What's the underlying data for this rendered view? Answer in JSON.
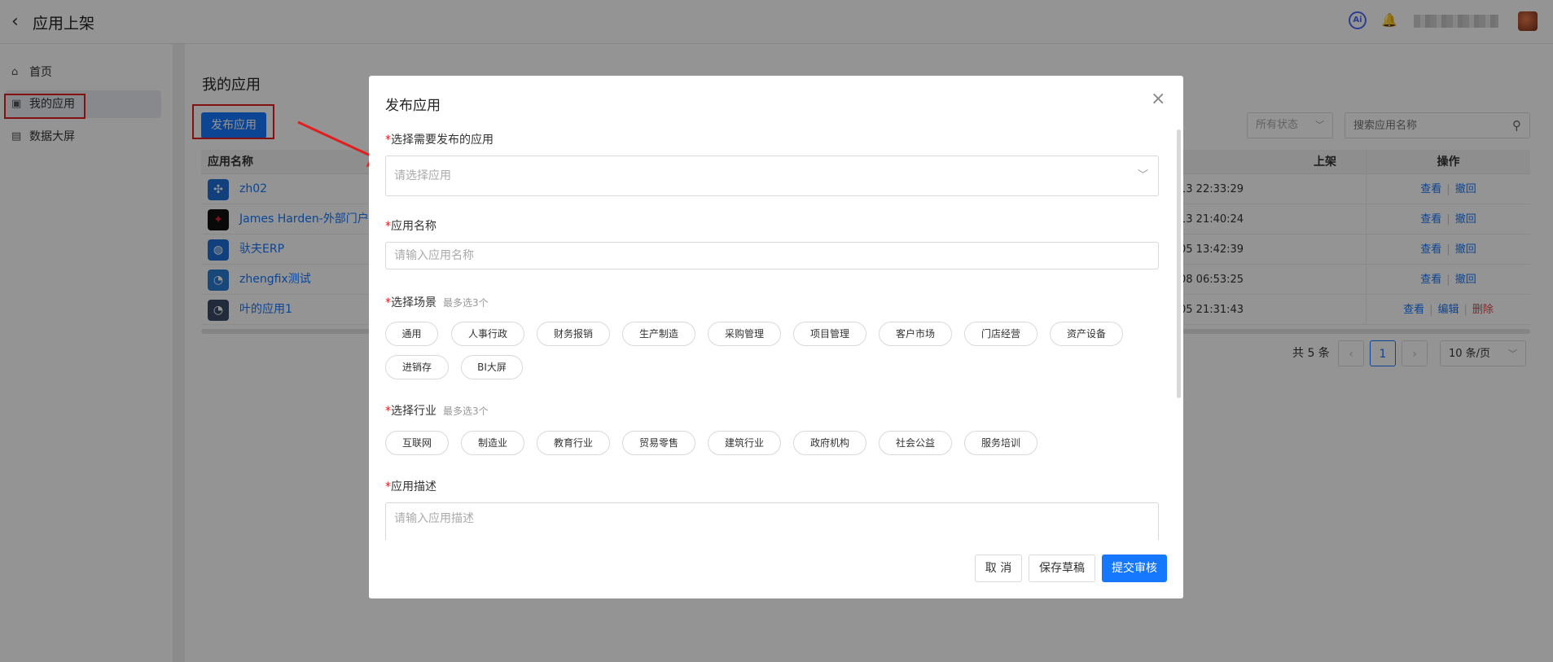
{
  "topbar": {
    "title": "应用上架",
    "ai_label": "Ai"
  },
  "sidebar": {
    "items": [
      {
        "label": "首页",
        "icon": "home-icon"
      },
      {
        "label": "我的应用",
        "icon": "app-box-icon"
      },
      {
        "label": "数据大屏",
        "icon": "monitor-icon"
      }
    ]
  },
  "main": {
    "title": "我的应用",
    "publish_button": "发布应用",
    "status_filter": "所有状态",
    "search_placeholder": "搜索应用名称",
    "table": {
      "headers": {
        "name": "应用名称",
        "date": "上架",
        "ops": "操作"
      },
      "rows": [
        {
          "name": "zh02",
          "date": "13 22:33:29",
          "icon_color": "#1f6fd8",
          "ops": [
            "查看",
            "撤回"
          ]
        },
        {
          "name": "James Harden-外部门户",
          "date": "13 21:40:24",
          "icon_color": "#111111",
          "ops": [
            "查看",
            "撤回"
          ]
        },
        {
          "name": "驮夫ERP",
          "date": "05 13:42:39",
          "icon_color": "#1f6fd8",
          "ops": [
            "查看",
            "撤回"
          ]
        },
        {
          "name": "zhengfix测试",
          "date": "08 06:53:25",
          "icon_color": "#2a7ad3",
          "ops": [
            "查看",
            "撤回"
          ]
        },
        {
          "name": "叶的应用1",
          "date": "05 21:31:43",
          "icon_color": "#3a4a66",
          "ops": [
            "查看",
            "编辑",
            "删除"
          ]
        }
      ]
    },
    "pagination": {
      "total": "共 5 条",
      "current": "1",
      "page_size": "10 条/页"
    }
  },
  "modal": {
    "title": "发布应用",
    "app_select": {
      "label": "选择需要发布的应用",
      "placeholder": "请选择应用"
    },
    "app_name": {
      "label": "应用名称",
      "placeholder": "请输入应用名称"
    },
    "scene": {
      "label": "选择场景",
      "hint": "最多选3个",
      "options": [
        "通用",
        "人事行政",
        "财务报销",
        "生产制造",
        "采购管理",
        "项目管理",
        "客户市场",
        "门店经营",
        "资产设备",
        "进销存",
        "BI大屏"
      ]
    },
    "industry": {
      "label": "选择行业",
      "hint": "最多选3个",
      "options": [
        "互联网",
        "制造业",
        "教育行业",
        "贸易零售",
        "建筑行业",
        "政府机构",
        "社会公益",
        "服务培训"
      ]
    },
    "description": {
      "label": "应用描述",
      "placeholder": "请输入应用描述"
    },
    "buttons": {
      "cancel": "取 消",
      "draft": "保存草稿",
      "submit": "提交审核"
    }
  },
  "colors": {
    "primary": "#1677ff",
    "danger": "#e64545",
    "highlight": "#e02020"
  }
}
